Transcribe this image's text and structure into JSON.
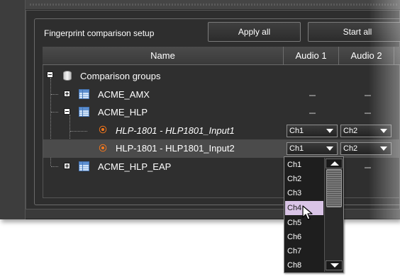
{
  "toolbar": {
    "label": "Fingerprint comparison setup",
    "apply_all": "Apply all",
    "start_all": "Start all"
  },
  "table": {
    "columns": [
      "Name",
      "Audio 1",
      "Audio 2"
    ],
    "rows": [
      {
        "name": "Comparison groups",
        "audio1": "",
        "audio2": ""
      },
      {
        "name": "ACME_AMX",
        "audio1": "---",
        "audio2": "---"
      },
      {
        "name": "ACME_HLP",
        "audio1": "---",
        "audio2": "---"
      },
      {
        "name": "HLP-1801 - HLP1801_Input1",
        "audio1": "Ch1",
        "audio2": "Ch2"
      },
      {
        "name": "HLP-1801 - HLP1801_Input2",
        "audio1": "Ch1",
        "audio2": "Ch2"
      },
      {
        "name": "ACME_HLP_EAP",
        "audio1": "",
        "audio2": "---"
      }
    ]
  },
  "dropdown": {
    "options": [
      "Ch1",
      "Ch2",
      "Ch3",
      "Ch4",
      "Ch5",
      "Ch6",
      "Ch7",
      "Ch8"
    ],
    "hovered": "Ch4"
  },
  "colors": {
    "background": "#3a3a3a",
    "hover_highlight": "#d9c4e6",
    "feed_icon": "#ff7a1a"
  },
  "icons": {
    "root": "database-icon",
    "group": "table-icon",
    "input": "feed-icon"
  }
}
